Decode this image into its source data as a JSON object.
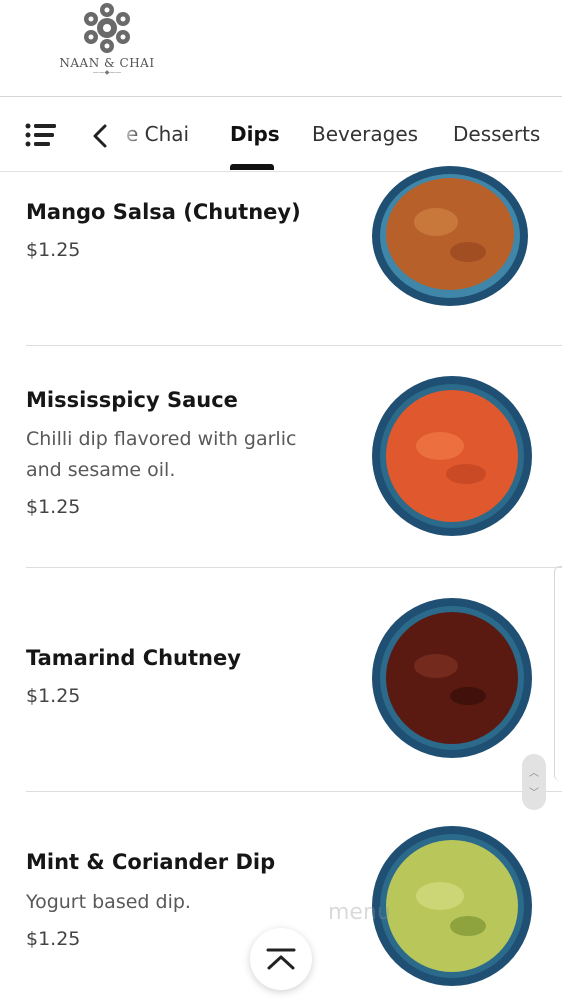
{
  "brand": {
    "name": "NAAN & CHAI"
  },
  "tabs": {
    "partial_prev": "e Chai",
    "items": [
      "Dips",
      "Beverages",
      "Desserts"
    ],
    "active": "Dips"
  },
  "menu_items": [
    {
      "name": "Mango Salsa (Chutney)",
      "description": "",
      "price": "$1.25"
    },
    {
      "name": "Mississpicy Sauce",
      "description": "Chilli dip flavored with garlic and sesame oil.",
      "price": "$1.25"
    },
    {
      "name": "Tamarind Chutney",
      "description": "",
      "price": "$1.25"
    },
    {
      "name": "Mint & Coriander Dip",
      "description": "Yogurt based dip.",
      "price": "$1.25"
    }
  ],
  "watermark": "menu",
  "colors": {
    "accent": "#111111",
    "bowl_rim": "#1f4f73",
    "mango": "#b8602a",
    "mississpicy": "#e0582e",
    "tamarind": "#5a1a12",
    "mint": "#b9c65a"
  },
  "icons": [
    "list-menu-icon",
    "chevron-left-icon",
    "chevron-up-icon",
    "mandala-logo-icon"
  ]
}
